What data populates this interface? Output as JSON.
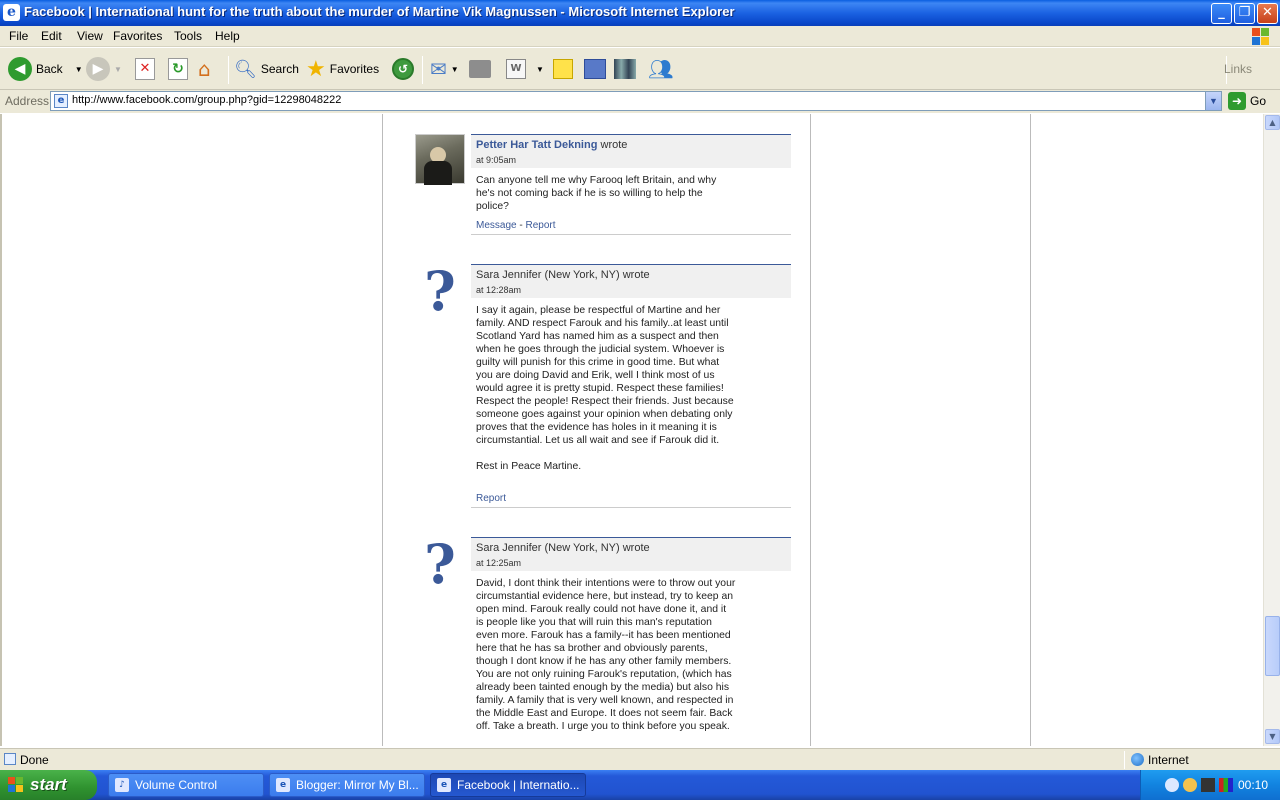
{
  "window": {
    "title": "Facebook | International hunt for the truth about the murder of Martine Vik Magnussen - Microsoft Internet Explorer"
  },
  "menu": [
    "File",
    "Edit",
    "View",
    "Favorites",
    "Tools",
    "Help"
  ],
  "toolbar": {
    "back_label": "Back",
    "search_label": "Search",
    "favorites_label": "Favorites",
    "links_label": "Links"
  },
  "address": {
    "label": "Address",
    "url": "http://www.facebook.com/group.php?gid=12298048222",
    "go_label": "Go"
  },
  "posts": [
    {
      "author": "Petter Har Tatt Dekning",
      "author_is_link": true,
      "wrote": "wrote",
      "time": "at 9:05am",
      "text": "Can anyone tell me why Farooq left Britain, and why he's not coming back if he is so willing to help the police?",
      "actions": [
        "Message",
        "Report"
      ],
      "avatar": "photo"
    },
    {
      "author": "Sara Jennifer (New York, NY)",
      "author_is_link": false,
      "wrote": "wrote",
      "time": "at 12:28am",
      "text": "I say it again, please be respectful of Martine and her family. AND respect Farouk and his family..at least until Scotland Yard has named him as a suspect and then when he goes through the judicial system. Whoever is guilty will punish for this crime in good time. But what you are doing David and Erik, well I think most of us would agree it is pretty stupid. Respect these families! Respect the people! Respect their friends. Just because someone goes against your opinion when debating only proves that the evidence has holes in it meaning it is circumstantial. Let us all wait and see if Farouk did it.\n\nRest in Peace Martine.",
      "actions": [
        "Report"
      ],
      "avatar": "question"
    },
    {
      "author": "Sara Jennifer (New York, NY)",
      "author_is_link": false,
      "wrote": "wrote",
      "time": "at 12:25am",
      "text": "David, I dont think their intentions were to throw out your circumstantial evidence here, but instead, try to keep an open mind. Farouk really could not have done it, and it is people like you that will ruin this man's reputation even more. Farouk has a family--it has been mentioned here that he has sa brother and obviously parents, though I dont know if he has any other family members. You are not only ruining Farouk's reputation, (which has already been tainted enough by the media) but also his family. A family that is very well known, and respected in the Middle East and Europe. It does not seem fair. Back off. Take a breath. I urge you to think before you speak.",
      "actions": [],
      "avatar": "question"
    }
  ],
  "status": {
    "left": "Done",
    "zone": "Internet"
  },
  "taskbar": {
    "start_label": "start",
    "tasks": [
      {
        "label": "Volume Control",
        "active": false
      },
      {
        "label": "Blogger: Mirror My Bl...",
        "active": false
      },
      {
        "label": "Facebook | Internatio...",
        "active": true
      }
    ],
    "clock": "00:10"
  }
}
